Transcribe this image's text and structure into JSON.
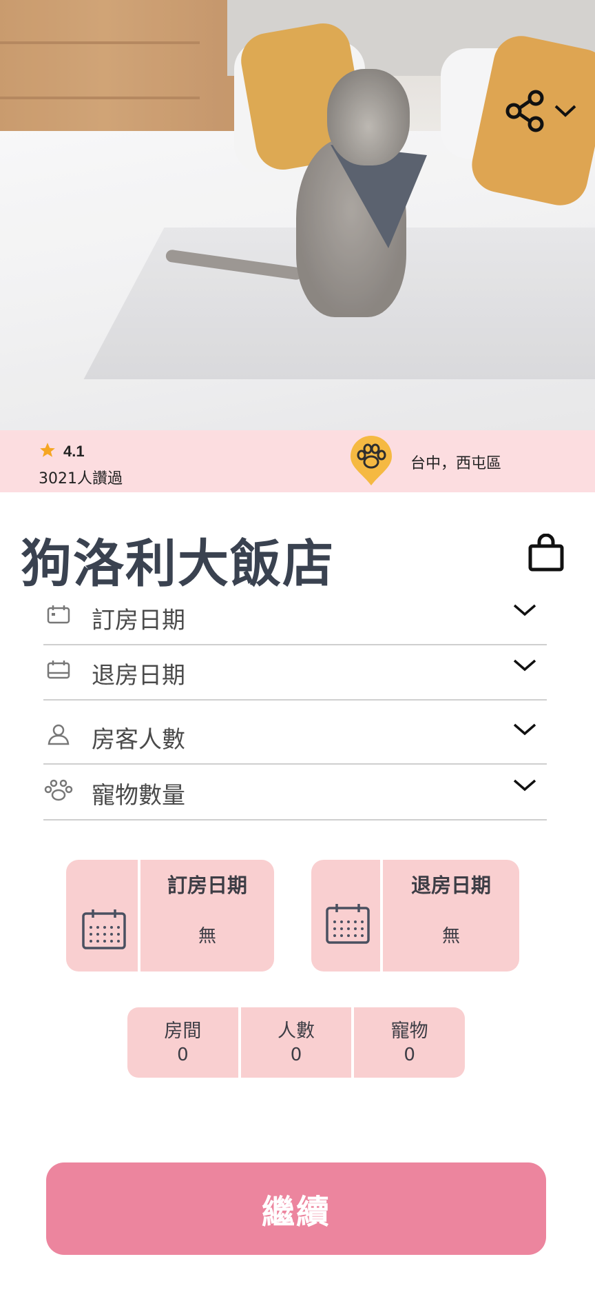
{
  "hero": {
    "image": "dog-on-bed-photo",
    "share_icon": "share-icon",
    "dropdown_icon": "chevron-down-icon"
  },
  "summary": {
    "rating": "4.1",
    "reviews": "3021人讚過",
    "location": "台中，西屯區",
    "star_color": "#f5a623",
    "pin_color": "#f5b942"
  },
  "hotel": {
    "name": "狗洛利大飯店",
    "bag_icon": "shopping-bag-icon"
  },
  "form": {
    "rows": [
      {
        "label": "訂房日期",
        "icon": "calendar-icon"
      },
      {
        "label": "退房日期",
        "icon": "calendar-icon"
      },
      {
        "label": "房客人數",
        "icon": "person-icon"
      },
      {
        "label": "寵物數量",
        "icon": "paw-icon"
      }
    ]
  },
  "dates": {
    "checkin": {
      "title": "訂房日期",
      "value": "無"
    },
    "checkout": {
      "title": "退房日期",
      "value": "無"
    }
  },
  "counts": [
    {
      "label": "房間",
      "value": "0"
    },
    {
      "label": "人數",
      "value": "0"
    },
    {
      "label": "寵物",
      "value": "0"
    }
  ],
  "actions": {
    "continue_label": "繼續"
  },
  "colors": {
    "accent": "#ec859e",
    "card": "#f9cfd0",
    "band": "#fcdde0",
    "title": "#3a4250"
  }
}
